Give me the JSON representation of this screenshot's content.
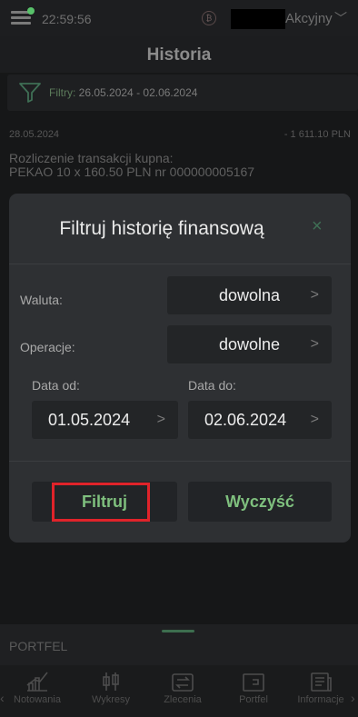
{
  "status_bar": {
    "time": "22:59:56",
    "account": "Akcyjny"
  },
  "header": {
    "title": "Historia"
  },
  "filter_bar": {
    "prefix": "Filtry:",
    "range": "26.05.2024 - 02.06.2024"
  },
  "transaction": {
    "date": "28.05.2024",
    "amount": "- 1 611.10 PLN",
    "line1": "Rozliczenie transakcji kupna:",
    "line2": "PEKAO 10 x 160.50 PLN nr 000000005167"
  },
  "dialog": {
    "title": "Filtruj historię finansową",
    "close": "×",
    "currency_label": "Waluta:",
    "currency_value": "dowolna",
    "operations_label": "Operacje:",
    "operations_value": "dowolne",
    "date_from_label": "Data od:",
    "date_from_value": "01.05.2024",
    "date_to_label": "Data do:",
    "date_to_value": "02.06.2024",
    "filter_button": "Filtruj",
    "clear_button": "Wyczyść"
  },
  "portfolio": {
    "label": "PORTFEL"
  },
  "nav": [
    {
      "label": "Notowania"
    },
    {
      "label": "Wykresy"
    },
    {
      "label": "Zlecenia"
    },
    {
      "label": "Portfel"
    },
    {
      "label": "Informacje"
    }
  ],
  "colors": {
    "accent_green": "#7fc07e",
    "highlight_red": "#e0232a"
  }
}
